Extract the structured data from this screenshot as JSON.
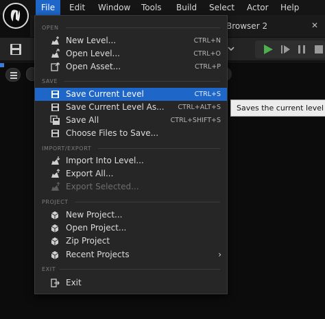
{
  "menubar": {
    "items": [
      {
        "label": "File"
      },
      {
        "label": "Edit"
      },
      {
        "label": "Window"
      },
      {
        "label": "Tools"
      },
      {
        "label": "Build"
      },
      {
        "label": "Select"
      },
      {
        "label": "Actor"
      },
      {
        "label": "Help"
      }
    ],
    "active": "File"
  },
  "tab": {
    "label": "Browser 2",
    "close": "✕"
  },
  "dropdown": {
    "sections": [
      {
        "heading": "OPEN"
      },
      {
        "heading": "SAVE"
      },
      {
        "heading": "IMPORT/EXPORT"
      },
      {
        "heading": "PROJECT"
      },
      {
        "heading": "EXIT"
      }
    ],
    "items": [
      {
        "label": "New Level...",
        "shortcut": "CTRL+N",
        "icon": "new-level-icon"
      },
      {
        "label": "Open Level...",
        "shortcut": "CTRL+O",
        "icon": "open-level-icon"
      },
      {
        "label": "Open Asset...",
        "shortcut": "CTRL+P",
        "icon": "open-asset-icon"
      },
      {
        "label": "Save Current Level",
        "shortcut": "CTRL+S",
        "icon": "save-icon"
      },
      {
        "label": "Save Current Level As...",
        "shortcut": "CTRL+ALT+S",
        "icon": "save-as-icon"
      },
      {
        "label": "Save All",
        "shortcut": "CTRL+SHIFT+S",
        "icon": "save-all-icon"
      },
      {
        "label": "Choose Files to Save...",
        "shortcut": "",
        "icon": "choose-files-icon"
      },
      {
        "label": "Import Into Level...",
        "shortcut": "",
        "icon": "import-icon"
      },
      {
        "label": "Export All...",
        "shortcut": "",
        "icon": "export-icon"
      },
      {
        "label": "Export Selected...",
        "shortcut": "",
        "icon": "export-selected-icon"
      },
      {
        "label": "New Project...",
        "shortcut": "",
        "icon": "new-project-icon"
      },
      {
        "label": "Open Project...",
        "shortcut": "",
        "icon": "open-project-icon"
      },
      {
        "label": "Zip Project",
        "shortcut": "",
        "icon": "zip-project-icon"
      },
      {
        "label": "Recent Projects",
        "shortcut": "",
        "icon": "recent-projects-icon",
        "submenu": "›"
      },
      {
        "label": "Exit",
        "shortcut": "",
        "icon": "exit-icon"
      }
    ]
  },
  "tooltip": {
    "text": "Saves the current level to d"
  },
  "colors": {
    "accent": "#1e66c8",
    "menu_bg": "#262626",
    "play_green": "#4caf50"
  }
}
